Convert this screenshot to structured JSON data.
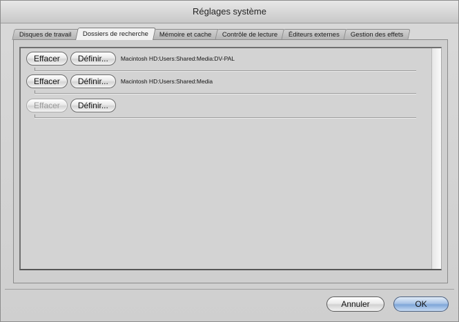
{
  "window": {
    "title": "Réglages système"
  },
  "tabs": [
    {
      "label": "Disques de travail",
      "active": false
    },
    {
      "label": "Dossiers de recherche",
      "active": true
    },
    {
      "label": "Mémoire et cache",
      "active": false
    },
    {
      "label": "Contrôle de lecture",
      "active": false
    },
    {
      "label": "Éditeurs externes",
      "active": false
    },
    {
      "label": "Gestion des effets",
      "active": false
    }
  ],
  "rows": [
    {
      "clear_label": "Effacer",
      "clear_enabled": true,
      "set_label": "Définir...",
      "path": "Macintosh HD:Users:Shared:Media:DV-PAL"
    },
    {
      "clear_label": "Effacer",
      "clear_enabled": true,
      "set_label": "Définir...",
      "path": "Macintosh HD:Users:Shared:Media"
    },
    {
      "clear_label": "Effacer",
      "clear_enabled": false,
      "set_label": "Définir...",
      "path": ""
    }
  ],
  "footer": {
    "cancel_label": "Annuler",
    "ok_label": "OK"
  },
  "colors": {
    "ok_button": "#8fb0dc",
    "window_bg": "#d2d2d2"
  }
}
